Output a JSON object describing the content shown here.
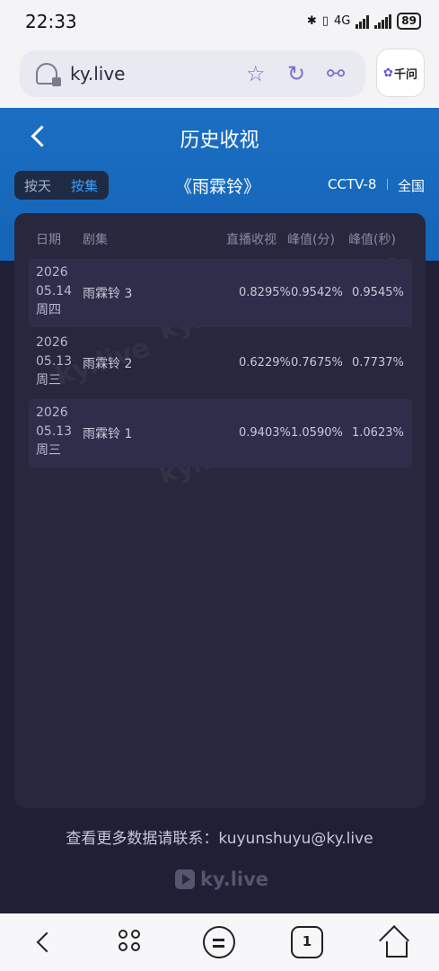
{
  "status_bar": {
    "time": "22:33",
    "network": "4G",
    "battery": "89"
  },
  "browser": {
    "url": "ky.live",
    "side_app_label": "千问"
  },
  "header": {
    "title": "历史收视",
    "toggle": {
      "by_day": "按天",
      "by_episode": "按集",
      "active": "by_episode"
    },
    "drama_title": "《雨霖铃》",
    "channel": "CCTV-8",
    "region": "全国"
  },
  "table": {
    "columns": [
      "日期",
      "剧集",
      "直播收视",
      "峰值(分)",
      "峰值(秒)"
    ],
    "rows": [
      {
        "year": "2026",
        "date": "05.14",
        "weekday": "周四",
        "episode": "雨霖铃 3",
        "live_rating": "0.8295%",
        "peak_minute": "0.9542%",
        "peak_second": "0.9545%"
      },
      {
        "year": "2026",
        "date": "05.13",
        "weekday": "周三",
        "episode": "雨霖铃 2",
        "live_rating": "0.6229%",
        "peak_minute": "0.7675%",
        "peak_second": "0.7737%"
      },
      {
        "year": "2026",
        "date": "05.13",
        "weekday": "周三",
        "episode": "雨霖铃 1",
        "live_rating": "0.9403%",
        "peak_minute": "1.0590%",
        "peak_second": "1.0623%"
      }
    ]
  },
  "footer": {
    "contact": "查看更多数据请联系：kuyunshuyu@ky.live",
    "logo_text": "ky.live"
  },
  "colors": {
    "header_blue": "#1b6ec2",
    "background": "#1f1f35",
    "card": "#27273d",
    "active_toggle": "#39a0ff"
  }
}
